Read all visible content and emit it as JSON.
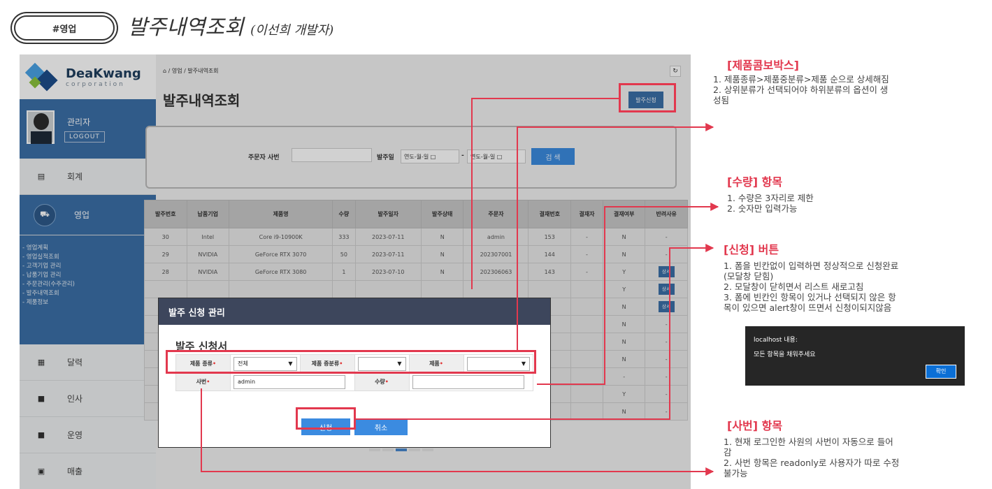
{
  "tag_label": "#영업",
  "doc_title": "발주내역조회",
  "doc_subtitle": "(이선희 개발자)",
  "app": {
    "logo_name": "DeaKwang",
    "logo_sub": "corporation",
    "user_name": "관리자",
    "logout_label": "LOGOUT",
    "nav": [
      {
        "label": "회계",
        "icon": "ledger-icon"
      },
      {
        "label": "영업",
        "icon": "truck-icon"
      },
      {
        "label": "달력",
        "icon": "calendar-icon"
      },
      {
        "label": "인사",
        "icon": "person-icon"
      },
      {
        "label": "운영",
        "icon": "settings-icon"
      },
      {
        "label": "매출",
        "icon": "monitor-icon"
      }
    ],
    "submenu": [
      "- 영업계획",
      "- 영업실적조회",
      "- 고객기업 관리",
      "- 납품기업 관리",
      "- 주문관리(수주관리)",
      "- 발주내역조회",
      "- 제품정보"
    ],
    "breadcrumb": "/ 영업 / 발주내역조회",
    "page_title": "발주내역조회",
    "request_button": "발주신청",
    "search": {
      "orderer_label": "주문자 사번",
      "date_label": "발주일",
      "date_placeholder": "연도-월-일",
      "button": "검 색"
    },
    "table": {
      "headers": [
        "발주번호",
        "납품기업",
        "제품명",
        "수량",
        "발주일자",
        "발주상태",
        "주문자",
        "결재번호",
        "결재자",
        "결재여부",
        "반려사유"
      ],
      "rows": [
        [
          "30",
          "Intel",
          "Core i9-10900K",
          "333",
          "2023-07-11",
          "N",
          "admin",
          "153",
          "-",
          "N",
          "-"
        ],
        [
          "29",
          "NVIDIA",
          "GeForce RTX 3070",
          "50",
          "2023-07-11",
          "N",
          "202307001",
          "144",
          "-",
          "N",
          "-"
        ],
        [
          "28",
          "NVIDIA",
          "GeForce RTX 3080",
          "1",
          "2023-07-10",
          "N",
          "202306063",
          "143",
          "-",
          "Y",
          "상세"
        ]
      ],
      "partial_rows_status": [
        "Y",
        "N",
        "N",
        "N",
        "N",
        "-",
        "Y",
        "N"
      ],
      "partial_rows_reason": [
        "상세",
        "상세",
        "-",
        "-",
        "-",
        "-",
        "-",
        "-"
      ],
      "detail_label": "상세"
    },
    "modal": {
      "title": "발주 신청 관리",
      "form_title": "발주 신청서",
      "product_type_label": "제품 종류",
      "product_type_value": "전체",
      "product_mid_label": "제품 중분류",
      "product_label": "제품",
      "empno_label": "사번",
      "empno_value": "admin",
      "qty_label": "수량",
      "required_mark": "•",
      "submit": "신청",
      "cancel": "취소"
    }
  },
  "annotations": {
    "combo": {
      "title": "[제품콤보박스]",
      "items": [
        "1.  제품종류>제품중분류>제품  순으로 상세해짐",
        "2.  상위분류가 선택되어야 하위분류의 옵션이 생",
        "     성됨"
      ]
    },
    "qty": {
      "title": "[수량] 항목",
      "items": [
        "1. 수량은 3자리로 제한",
        "2. 숫자만 입력가능"
      ]
    },
    "submit": {
      "title": "[신청] 버튼",
      "items": [
        "1.  폼을 빈칸없이 입력하면 정상적으로 신청완료",
        "     (모달창 닫힘)",
        "2.  모달창이 닫히면서 리스트 새로고침",
        "3.  폼에 빈칸인 항목이 있거나 선택되지 않은 항",
        "     목이 있으면 alert창이 뜨면서 신청이되지않음"
      ]
    },
    "alert": {
      "host": "localhost 내용:",
      "message": "모든 항목을 채워주세요",
      "ok": "확인"
    },
    "empno": {
      "title": "[사번] 항목",
      "items": [
        "1.  현재 로그인한 사원의 사번이 자동으로 들어",
        "     감",
        "2.  사번 항목은 readonly로 사용자가 따로 수정",
        "     불가능"
      ]
    }
  },
  "colors": {
    "annotation_red": "#e2384e",
    "brand_blue": "#3b6fa8",
    "button_blue": "#3b8be0"
  }
}
